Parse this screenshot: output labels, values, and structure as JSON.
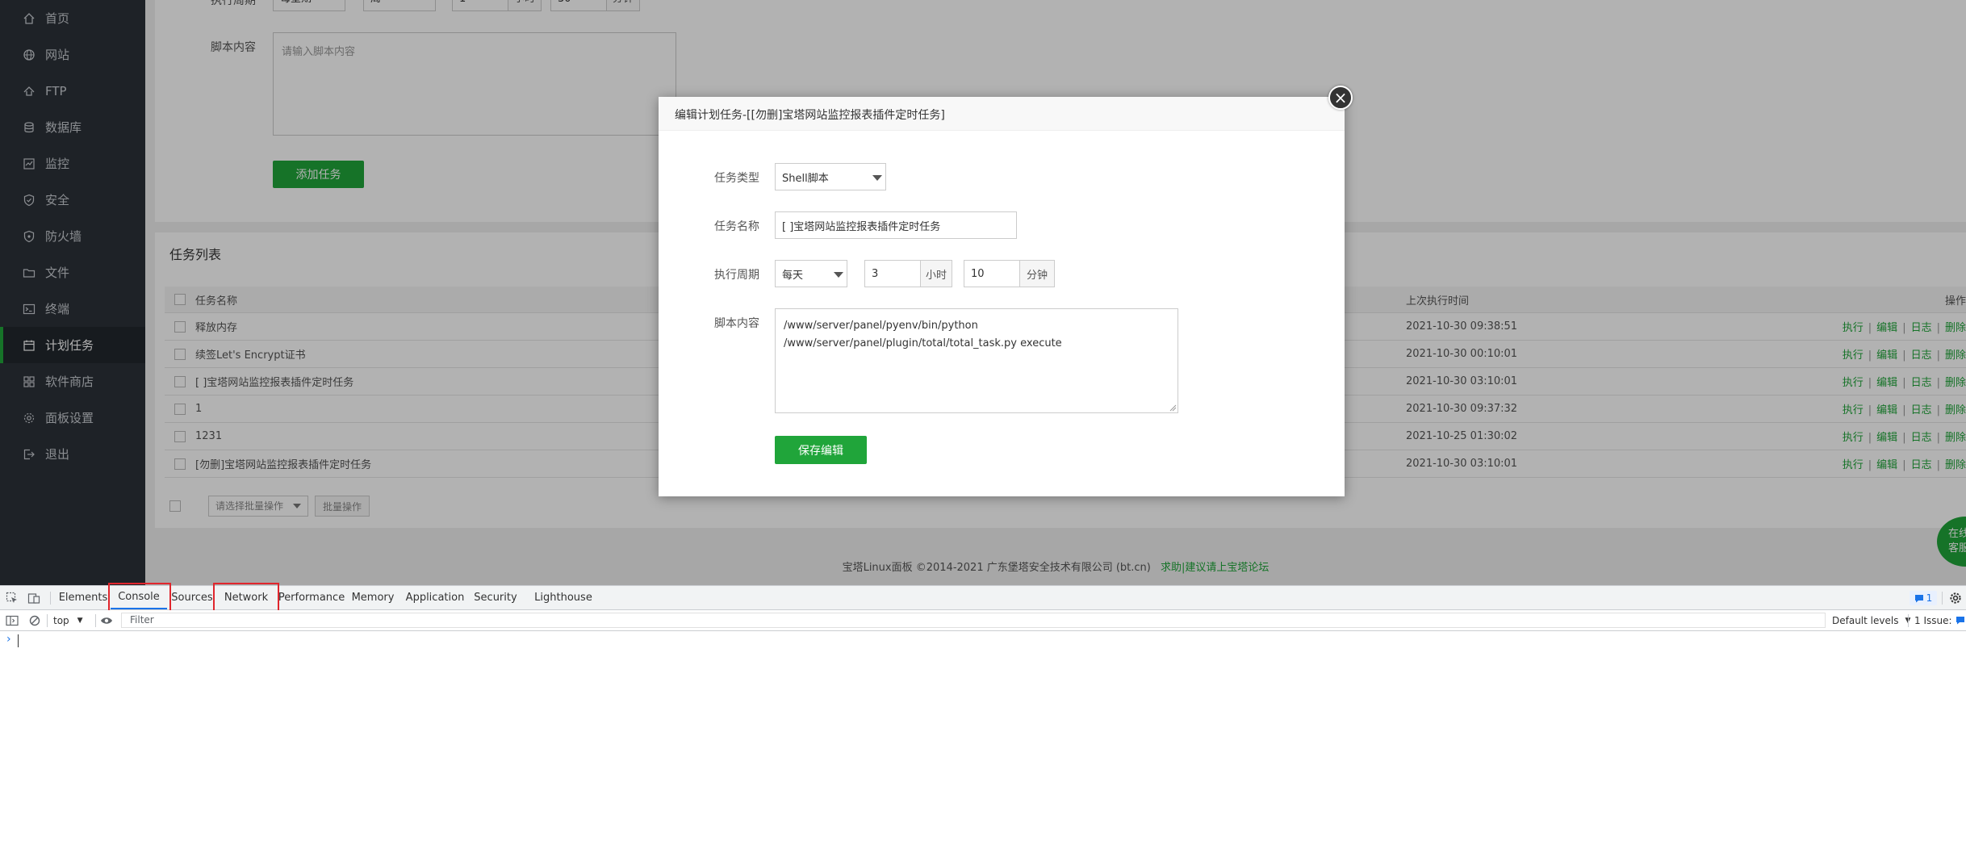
{
  "sidebar": {
    "items": [
      {
        "label": "首页",
        "icon": "home-icon"
      },
      {
        "label": "网站",
        "icon": "globe-icon"
      },
      {
        "label": "FTP",
        "icon": "ftp-icon"
      },
      {
        "label": "数据库",
        "icon": "database-icon"
      },
      {
        "label": "监控",
        "icon": "monitor-icon"
      },
      {
        "label": "安全",
        "icon": "shield-icon"
      },
      {
        "label": "防火墙",
        "icon": "firewall-icon"
      },
      {
        "label": "文件",
        "icon": "folder-icon"
      },
      {
        "label": "终端",
        "icon": "terminal-icon"
      },
      {
        "label": "计划任务",
        "icon": "calendar-icon",
        "active": true
      },
      {
        "label": "软件商店",
        "icon": "grid-icon"
      },
      {
        "label": "面板设置",
        "icon": "gear-icon"
      },
      {
        "label": "退出",
        "icon": "logout-icon"
      }
    ]
  },
  "top_form": {
    "cycle_label": "执行周期",
    "cycle_value": "每星期",
    "day_value": "周一",
    "hour_value": "1",
    "hour_unit": "小时",
    "minute_value": "30",
    "minute_unit": "分钟",
    "script_label": "脚本内容",
    "script_placeholder": "请输入脚本内容",
    "add_button": "添加任务"
  },
  "task_list": {
    "title": "任务列表",
    "columns": {
      "name": "任务名称",
      "last_run": "上次执行时间",
      "ops": "操作"
    },
    "rows": [
      {
        "name": "释放内存",
        "last_run": "2021-10-30 09:38:51"
      },
      {
        "name": "续签Let's Encrypt证书",
        "last_run": "2021-10-30 00:10:01"
      },
      {
        "name": "[ ]宝塔网站监控报表插件定时任务",
        "last_run": "2021-10-30 03:10:01"
      },
      {
        "name": "1",
        "last_run": "2021-10-30 09:37:32"
      },
      {
        "name": "1231",
        "last_run": "2021-10-25 01:30:02"
      },
      {
        "name": "[勿删]宝塔网站监控报表插件定时任务",
        "last_run": "2021-10-30 03:10:01"
      }
    ],
    "ops": {
      "run": "执行",
      "edit": "编辑",
      "log": "日志",
      "delete": "删除"
    },
    "batch_select": "请选择批量操作",
    "batch_button": "批量操作"
  },
  "footer": {
    "copyright": "宝塔Linux面板 ©2014-2021 广东堡塔安全技术有限公司 (bt.cn)",
    "link": "求助|建议请上宝塔论坛"
  },
  "chat": {
    "line1": "在线",
    "line2": "客服"
  },
  "modal": {
    "title": "编辑计划任务-[[勿删]宝塔网站监控报表插件定时任务]",
    "type_label": "任务类型",
    "type_value": "Shell脚本",
    "name_label": "任务名称",
    "name_value": "[ ]宝塔网站监控报表插件定时任务",
    "cycle_label": "执行周期",
    "cycle_value": "每天",
    "hour_value": "3",
    "hour_unit": "小时",
    "minute_value": "10",
    "minute_unit": "分钟",
    "script_label": "脚本内容",
    "script_value": "/www/server/panel/pyenv/bin/python\n/www/server/panel/plugin/total/total_task.py execute",
    "save_button": "保存编辑"
  },
  "devtools": {
    "tabs": [
      "Elements",
      "Console",
      "Sources",
      "Network",
      "Performance",
      "Memory",
      "Application",
      "Security",
      "Lighthouse"
    ],
    "active_tab": "Console",
    "context": "top",
    "filter_placeholder": "Filter",
    "levels": "Default levels",
    "message_count": "1",
    "issues": "1 Issue:",
    "prompt": "›"
  },
  "colors": {
    "accent": "#20a53a",
    "sidebar_bg": "#2c3138",
    "highlight_box": "#e0262d",
    "devtools_active": "#1a73e8"
  }
}
